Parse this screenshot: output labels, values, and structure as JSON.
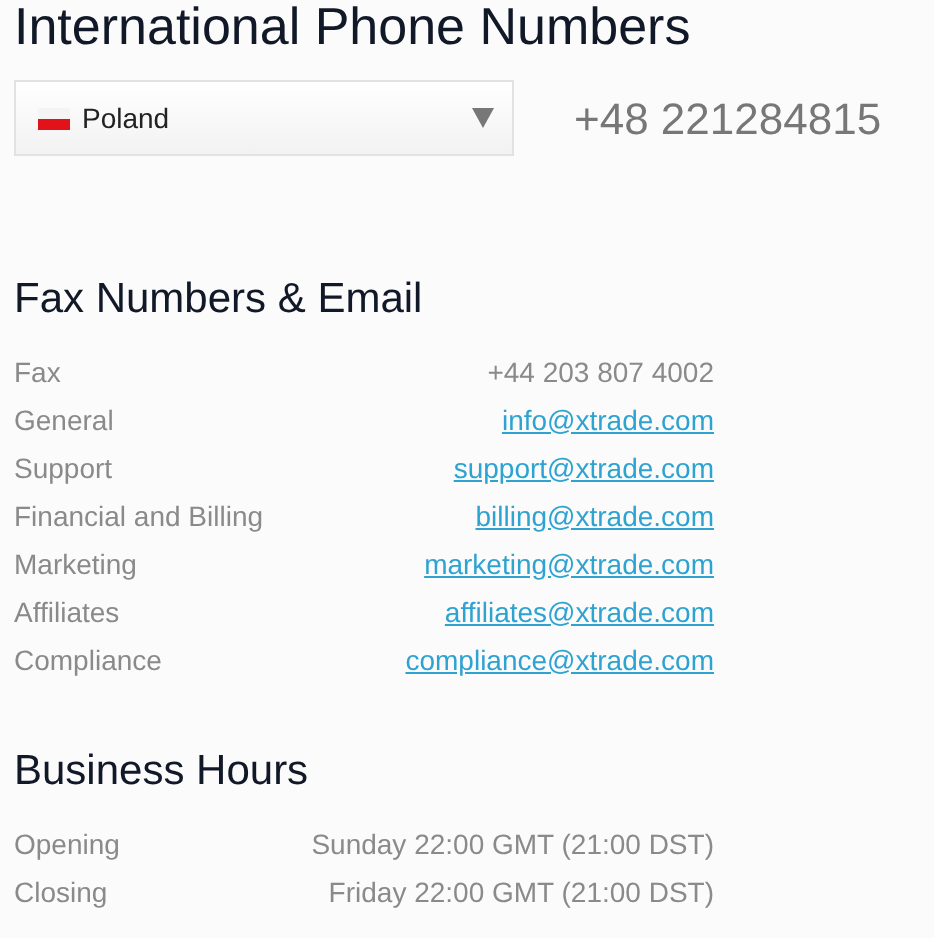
{
  "title": "International Phone Numbers",
  "country_select": {
    "value": "Poland"
  },
  "phone": "+48 221284815",
  "sections": [
    {
      "heading": "Fax Numbers & Email",
      "rows": [
        {
          "label": "Fax",
          "value": "+44 203 807 4002",
          "kind": "text"
        },
        {
          "label": "General",
          "value": "info@xtrade.com",
          "kind": "link"
        },
        {
          "label": "Support",
          "value": "support@xtrade.com",
          "kind": "link"
        },
        {
          "label": "Financial and Billing",
          "value": "billing@xtrade.com",
          "kind": "link"
        },
        {
          "label": "Marketing",
          "value": "marketing@xtrade.com",
          "kind": "link"
        },
        {
          "label": "Affiliates",
          "value": "affiliates@xtrade.com",
          "kind": "link"
        },
        {
          "label": "Compliance",
          "value": "compliance@xtrade.com",
          "kind": "link"
        }
      ]
    },
    {
      "heading": "Business Hours",
      "rows": [
        {
          "label": "Opening",
          "value": "Sunday 22:00 GMT (21:00 DST)",
          "kind": "text"
        },
        {
          "label": "Closing",
          "value": "Friday 22:00 GMT (21:00 DST)",
          "kind": "text"
        }
      ]
    }
  ]
}
